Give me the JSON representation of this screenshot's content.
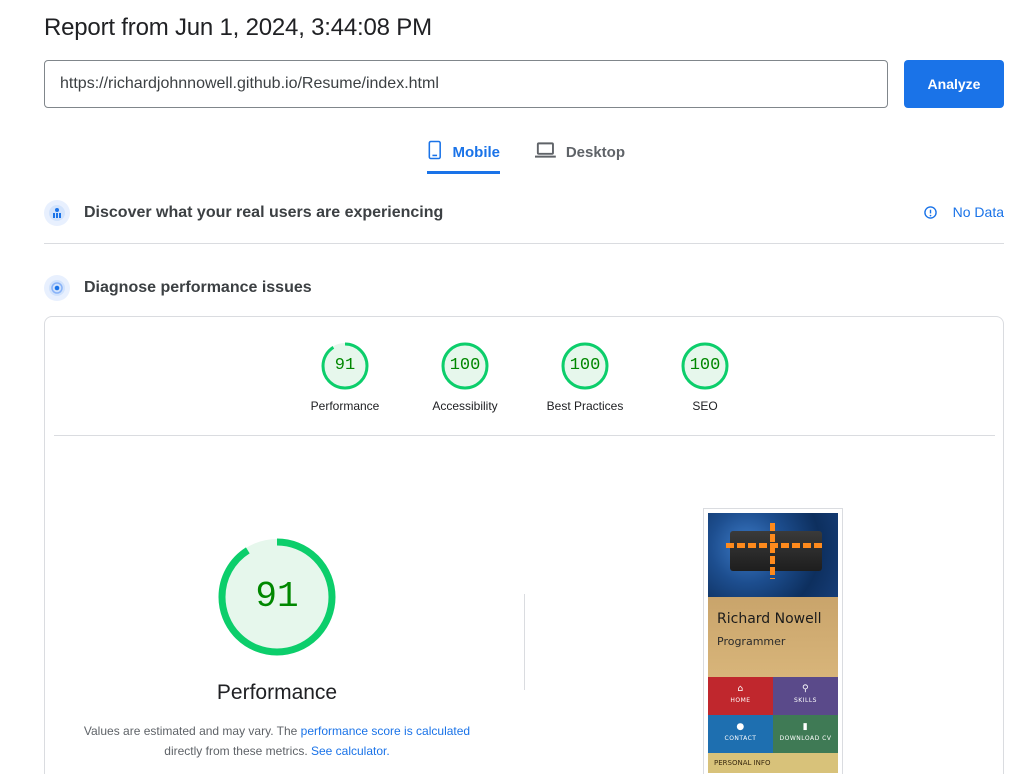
{
  "header": {
    "title": "Report from Jun 1, 2024, 3:44:08 PM"
  },
  "url_input": {
    "value": "https://richardjohnnowell.github.io/Resume/index.html"
  },
  "analyze_button": {
    "label": "Analyze"
  },
  "tabs": [
    {
      "label": "Mobile",
      "active": true,
      "icon": "smartphone-icon"
    },
    {
      "label": "Desktop",
      "active": false,
      "icon": "laptop-icon"
    }
  ],
  "field_data": {
    "title": "Discover what your real users are experiencing",
    "status": "No Data",
    "icon": "users-icon",
    "status_icon": "info-icon"
  },
  "lab_data": {
    "title": "Diagnose performance issues",
    "icon": "radar-icon"
  },
  "scores": [
    {
      "label": "Performance",
      "value": 91
    },
    {
      "label": "Accessibility",
      "value": 100
    },
    {
      "label": "Best Practices",
      "value": 100
    },
    {
      "label": "SEO",
      "value": 100
    }
  ],
  "performance": {
    "score": "91",
    "label": "Performance",
    "note_prefix": "Values are estimated and may vary. The ",
    "note_link1": "performance score is calculated",
    "note_middle": " directly from these metrics. ",
    "note_link2": "See calculator."
  },
  "screenshot_preview": {
    "name": "Richard Nowell",
    "role": "Programmer",
    "tiles": [
      "HOME",
      "SKILLS",
      "CONTACT",
      "DOWNLOAD CV"
    ],
    "section": "PERSONAL INFO"
  },
  "colors": {
    "accent": "#1a73e8",
    "pass": "#0cce6b",
    "pass_text": "#008800",
    "pass_fill": "#e6f7ec"
  }
}
